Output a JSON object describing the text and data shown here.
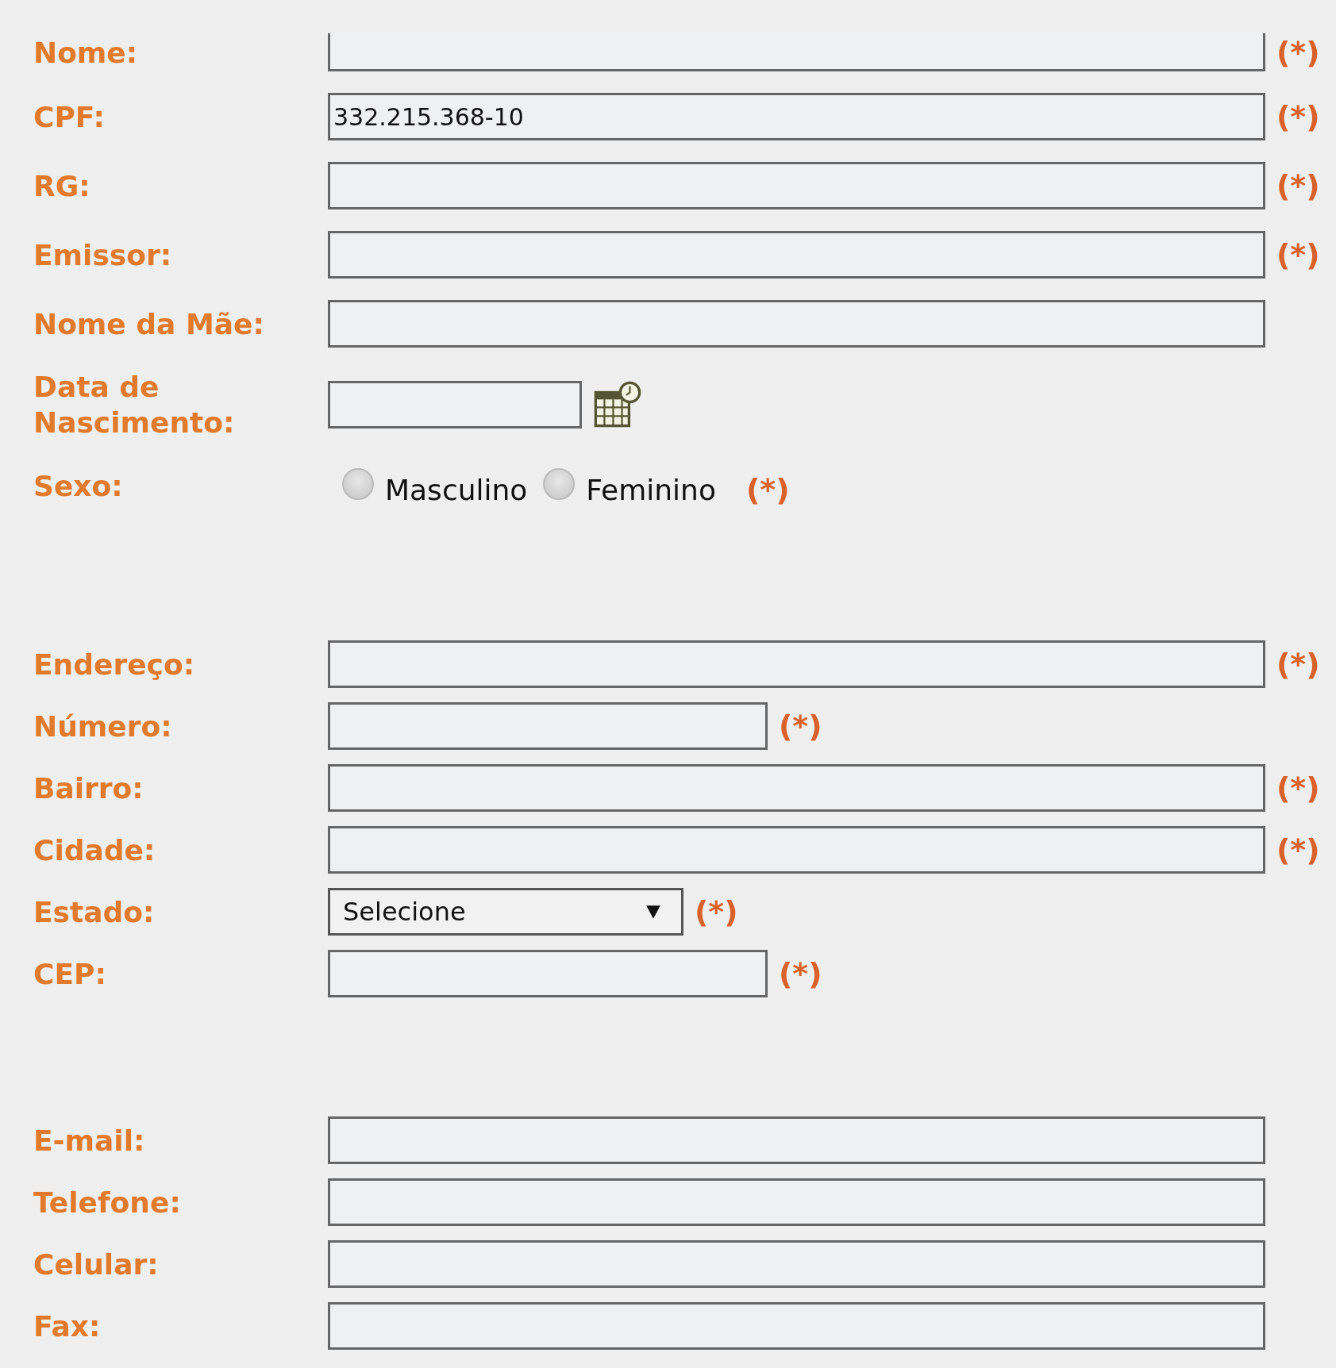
{
  "sections": [
    {
      "fields": [
        {
          "label": "Nome:",
          "kind": "text",
          "mark": "(*)",
          "cut": true
        },
        {
          "label": "CPF:",
          "kind": "text",
          "value": "332.215.368-10",
          "mark": "(*)"
        },
        {
          "label": "RG:",
          "kind": "text",
          "mark": "(*)"
        },
        {
          "label": "Emissor:",
          "kind": "text",
          "mark": "(*)"
        },
        {
          "label": "Nome da Mãe:",
          "kind": "text"
        },
        {
          "label": "Data de Nascimento:",
          "kind": "date"
        },
        {
          "label": "Sexo:",
          "kind": "radio",
          "options": [
            {
              "label": "Masculino",
              "selected": false
            },
            {
              "label": "Feminino",
              "selected": false
            }
          ],
          "mark": "(*)"
        }
      ]
    },
    {
      "fields": [
        {
          "label": "Endereço:",
          "kind": "text",
          "mark": "(*)"
        },
        {
          "label": "Número:",
          "kind": "short",
          "mark": "(*)"
        },
        {
          "label": "Bairro:",
          "kind": "text",
          "mark": "(*)"
        },
        {
          "label": "Cidade:",
          "kind": "text",
          "mark": "(*)"
        },
        {
          "label": "Estado:",
          "kind": "select",
          "value": "Selecione",
          "mark": "(*)"
        },
        {
          "label": "CEP:",
          "kind": "short",
          "mark": "(*)"
        }
      ]
    },
    {
      "fields": [
        {
          "label": "E-mail:",
          "kind": "text"
        },
        {
          "label": "Telefone:",
          "kind": "text"
        },
        {
          "label": "Celular:",
          "kind": "text"
        },
        {
          "label": "Fax:",
          "kind": "text"
        }
      ]
    }
  ]
}
